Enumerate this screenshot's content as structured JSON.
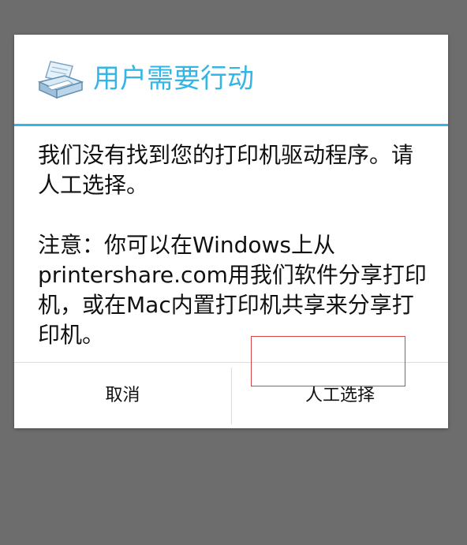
{
  "dialog": {
    "icon": "printer-icon",
    "title": "用户需要行动",
    "message_paragraphs": [
      "我们没有找到您的打印机驱动程序。请人工选择。",
      "注意：你可以在Windows上从printershare.com用我们软件分享打印机，或在Mac内置打印机共享来分享打印机。"
    ],
    "buttons": {
      "cancel_label": "取消",
      "manual_select_label": "人工选择"
    }
  },
  "colors": {
    "accent": "#33b5e5",
    "backdrop": "#6d6d6d",
    "highlight": "#d64545"
  }
}
